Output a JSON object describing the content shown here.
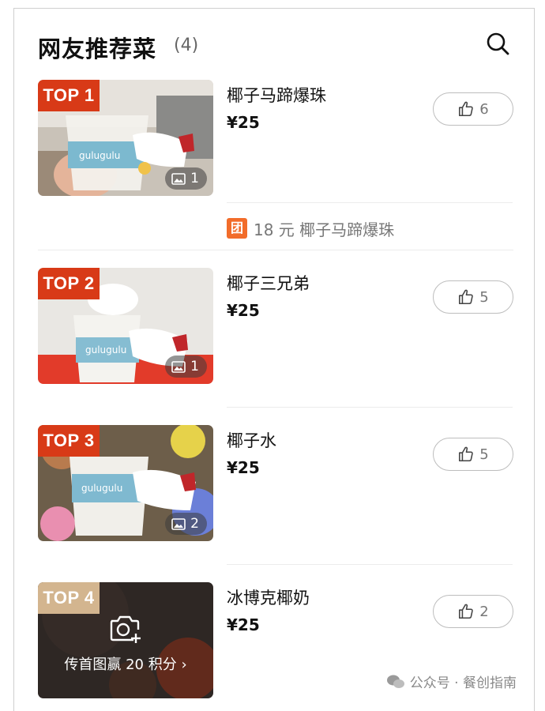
{
  "header": {
    "title": "网友推荐菜",
    "count": "(4)",
    "search_icon": "search-icon"
  },
  "dishes": [
    {
      "rank": "TOP 1",
      "name": "椰子马蹄爆珠",
      "price": "¥25",
      "likes": "6",
      "image_count": "1"
    },
    {
      "rank": "TOP 2",
      "name": "椰子三兄弟",
      "price": "¥25",
      "likes": "5",
      "image_count": "1"
    },
    {
      "rank": "TOP 3",
      "name": "椰子水",
      "price": "¥25",
      "likes": "5",
      "image_count": "2"
    },
    {
      "rank": "TOP 4",
      "name": "冰博克椰奶",
      "price": "¥25",
      "likes": "2",
      "upload_text": "传首图赢 20 积分"
    }
  ],
  "deal": {
    "badge": "团",
    "text": "18 元 椰子马蹄爆珠"
  },
  "watermark": {
    "text": "公众号 · 餐创指南"
  },
  "colors": {
    "badge_red": "#d83a17",
    "badge_tan": "#d3b58f",
    "deal_orange": "#f26c2a"
  }
}
